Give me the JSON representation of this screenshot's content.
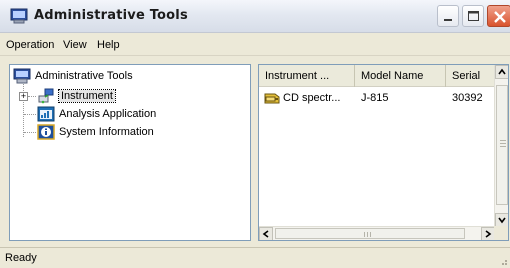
{
  "window": {
    "title": "Administrative Tools",
    "accent": "#d9532e"
  },
  "menu": {
    "items": [
      "Operation",
      "View",
      "Help"
    ]
  },
  "tree": {
    "root_label": "Administrative Tools",
    "items": [
      {
        "label": "Instrument",
        "icon": "instrument-icon",
        "selected": true,
        "expandable": true
      },
      {
        "label": "Analysis Application",
        "icon": "analysis-application-icon"
      },
      {
        "label": "System Information",
        "icon": "system-information-icon"
      }
    ]
  },
  "list": {
    "columns": [
      "Instrument ...",
      "Model Name",
      "Serial"
    ],
    "rows": [
      {
        "instrument": "CD spectr...",
        "model": "J-815",
        "serial": "30392"
      }
    ]
  },
  "status": {
    "text": "Ready"
  }
}
